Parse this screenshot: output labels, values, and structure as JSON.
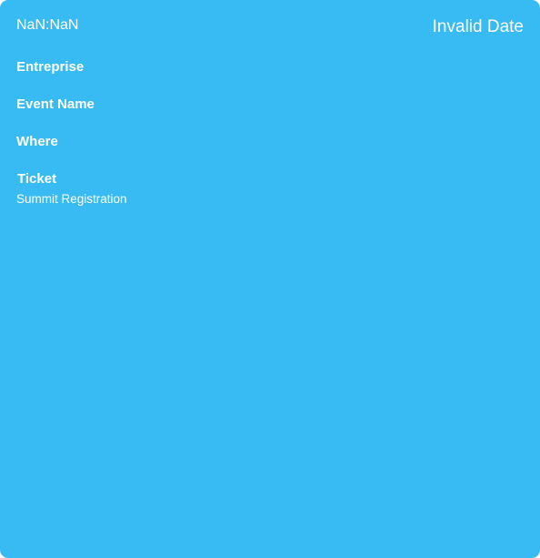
{
  "event_card": {
    "background_color": "#38bbf2",
    "text_color": "#ffffff",
    "time": "NaN:NaN",
    "date": "Invalid Date",
    "labels": {
      "company": "Entreprise",
      "event_name": "Event Name",
      "where": "Where",
      "ticket": "Ticket"
    },
    "ticket_value": "Summit Registration"
  }
}
